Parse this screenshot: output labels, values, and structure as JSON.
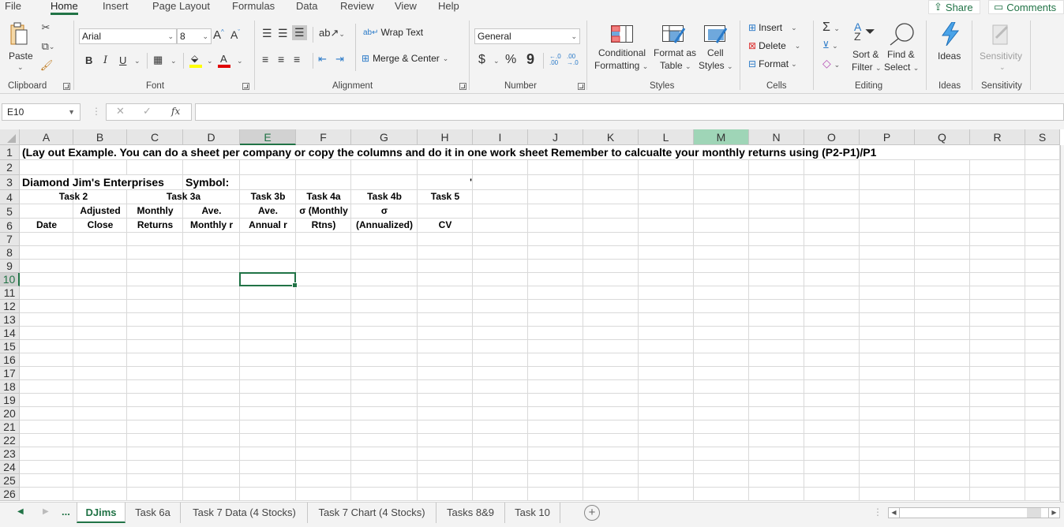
{
  "menu": {
    "tabs": [
      "File",
      "Home",
      "Insert",
      "Page Layout",
      "Formulas",
      "Data",
      "Review",
      "View",
      "Help"
    ],
    "active_tab": "Home",
    "share_label": "Share",
    "comments_label": "Comments"
  },
  "ribbon": {
    "clipboard": {
      "paste_label": "Paste",
      "group_label": "Clipboard"
    },
    "font": {
      "font_name": "Arial",
      "font_size": "8",
      "bold": "B",
      "italic": "I",
      "underline": "U",
      "group_label": "Font",
      "fill_color": "#ffff00",
      "font_color": "#e00000"
    },
    "alignment": {
      "wrap_text": "Wrap Text",
      "merge_center": "Merge & Center",
      "group_label": "Alignment"
    },
    "number": {
      "format": "General",
      "currency": "$",
      "percent": "%",
      "comma": "9",
      "inc_decimal": "←.0 .00",
      "dec_decimal": ".00 →.0",
      "group_label": "Number"
    },
    "styles": {
      "conditional_1": "Conditional",
      "conditional_2": "Formatting",
      "format_table_1": "Format as",
      "format_table_2": "Table",
      "cell_styles_1": "Cell",
      "cell_styles_2": "Styles",
      "group_label": "Styles"
    },
    "cells": {
      "insert": "Insert",
      "delete": "Delete",
      "format": "Format",
      "group_label": "Cells"
    },
    "editing": {
      "sum": "Σ",
      "sort_1": "Sort &",
      "sort_2": "Filter",
      "find_1": "Find &",
      "find_2": "Select",
      "group_label": "Editing"
    },
    "ideas": {
      "label": "Ideas",
      "group_label": "Ideas"
    },
    "sensitivity": {
      "label": "Sensitivity",
      "group_label": "Sensitivity"
    }
  },
  "formula_bar": {
    "name_box": "E10",
    "cancel": "✕",
    "enter": "✓",
    "fx": "fx",
    "value": ""
  },
  "grid": {
    "columns": [
      "A",
      "B",
      "C",
      "D",
      "E",
      "F",
      "G",
      "H",
      "I",
      "J",
      "K",
      "L",
      "M",
      "N",
      "O",
      "P",
      "Q",
      "R",
      "S"
    ],
    "rows": [
      "1",
      "2",
      "3",
      "4",
      "5",
      "6",
      "7",
      "8",
      "9",
      "10",
      "11",
      "12",
      "13",
      "14",
      "15",
      "16",
      "17",
      "18",
      "19",
      "20",
      "21",
      "22",
      "23",
      "24",
      "25",
      "26"
    ],
    "selected_cell": "E10",
    "cells": {
      "A1": "(Lay out Example. You can do a sheet per company or copy the columns and do it in one work sheet Remember to calcualte your monthly returns  using (P2-P1)/P1",
      "A3": "Diamond Jim's Enterprises",
      "D3": "Symbol:",
      "H3": "'",
      "A4": "Task 2",
      "C4": "Task 3a",
      "E4": "Task 3b",
      "F4": "Task 4a",
      "G4": "Task 4b",
      "H4": "Task 5",
      "B5": "Adjusted",
      "C5": "Monthly",
      "D5": "Ave.",
      "E5": "Ave.",
      "F5": "σ (Monthly",
      "G5": "σ",
      "A6": "Date",
      "B6": "Close",
      "C6": "Returns",
      "D6": "Monthly r",
      "E6": "Annual r",
      "F6": "Rtns)",
      "G6": "(Annualized)",
      "H6": "CV"
    }
  },
  "sheets": {
    "ellipsis": "...",
    "tabs": [
      "DJims",
      "Task 6a",
      "Task 7 Data (4 Stocks)",
      "Task 7 Chart (4 Stocks)",
      "Tasks 8&9",
      "Task 10"
    ],
    "active": "DJims",
    "add": "+"
  }
}
